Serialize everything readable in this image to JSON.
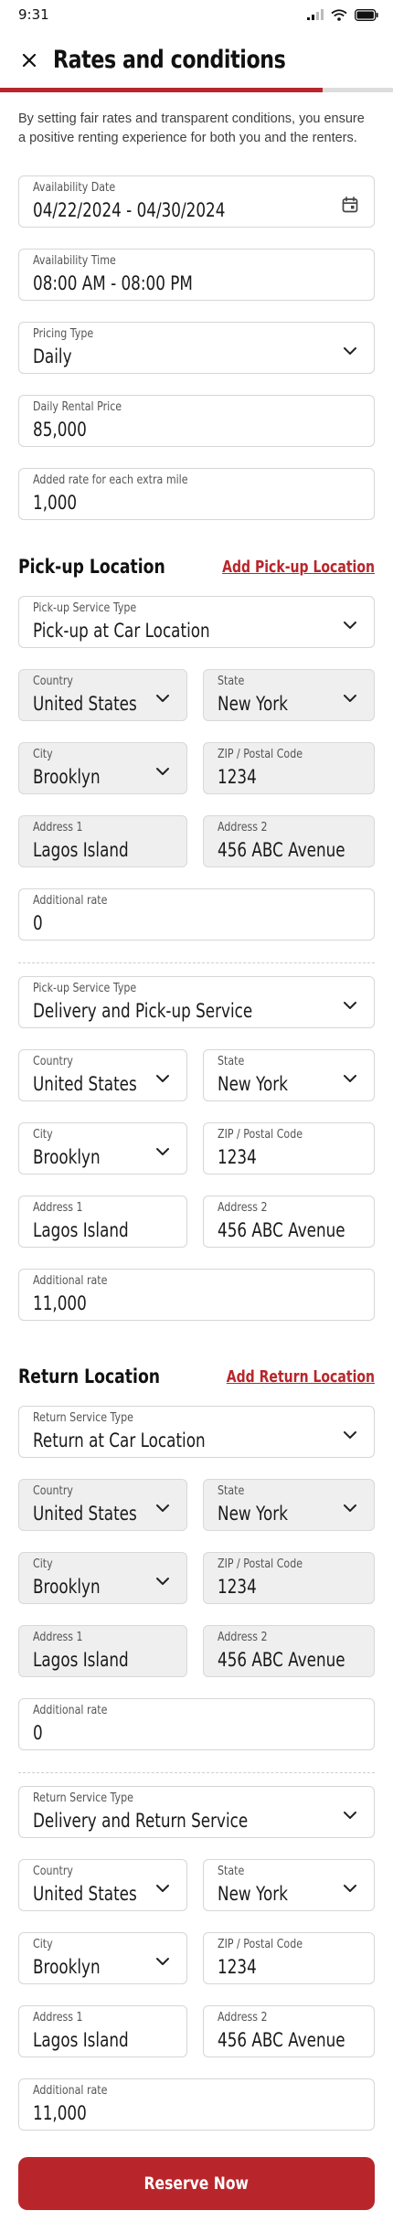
{
  "status_bar": {
    "time": "9:31",
    "icons": [
      "signal-icon",
      "wifi-icon",
      "battery-icon"
    ]
  },
  "header": {
    "title": "Rates and conditions",
    "close_icon": "close-icon"
  },
  "progress": {
    "fraction": 0.82
  },
  "colors": {
    "accent": "#b8262b",
    "field_border": "#d6d6d6",
    "disabled_bg": "#efefef"
  },
  "intro": "By setting fair rates and transparent conditions, you ensure a positive renting experience for both you and the renters.",
  "availability_date": {
    "label": "Availability Date",
    "value": "04/22/2024 - 04/30/2024",
    "icon": "calendar-icon"
  },
  "availability_time": {
    "label": "Availability Time",
    "value": "08:00 AM - 08:00 PM"
  },
  "pricing_type": {
    "label": "Pricing Type",
    "value": "Daily"
  },
  "daily_price": {
    "label": "Daily Rental Price",
    "value": "85,000"
  },
  "extra_mile": {
    "label": "Added rate for each extra mile",
    "value": "1,000"
  },
  "pickup": {
    "title": "Pick-up Location",
    "add_link": "Add Pick-up Location",
    "entries": [
      {
        "service_label": "Pick-up Service Type",
        "service_value": "Pick-up at Car Location",
        "country_label": "Country",
        "country_value": "United States",
        "state_label": "State",
        "state_value": "New York",
        "city_label": "City",
        "city_value": "Brooklyn",
        "zip_label": "ZIP / Postal Code",
        "zip_value": "1234",
        "address1_label": "Address 1",
        "address1_value": "Lagos Island",
        "address2_label": "Address 2",
        "address2_value": "456 ABC Avenue",
        "rate_label": "Additional rate",
        "rate_value": "0"
      },
      {
        "service_label": "Pick-up Service Type",
        "service_value": "Delivery and Pick-up Service",
        "country_label": "Country",
        "country_value": "United States",
        "state_label": "State",
        "state_value": "New York",
        "city_label": "City",
        "city_value": "Brooklyn",
        "zip_label": "ZIP / Postal Code",
        "zip_value": "1234",
        "address1_label": "Address 1",
        "address1_value": "Lagos Island",
        "address2_label": "Address 2",
        "address2_value": "456 ABC Avenue",
        "rate_label": "Additional rate",
        "rate_value": "11,000"
      }
    ]
  },
  "return": {
    "title": "Return Location",
    "add_link": "Add Return Location",
    "entries": [
      {
        "service_label": "Return Service Type",
        "service_value": "Return at Car Location",
        "country_label": "Country",
        "country_value": "United States",
        "state_label": "State",
        "state_value": "New York",
        "city_label": "City",
        "city_value": "Brooklyn",
        "zip_label": "ZIP / Postal Code",
        "zip_value": "1234",
        "address1_label": "Address 1",
        "address1_value": "Lagos Island",
        "address2_label": "Address 2",
        "address2_value": "456 ABC Avenue",
        "rate_label": "Additional rate",
        "rate_value": "0"
      },
      {
        "service_label": "Return Service Type",
        "service_value": "Delivery and Return Service",
        "country_label": "Country",
        "country_value": "United States",
        "state_label": "State",
        "state_value": "New York",
        "city_label": "City",
        "city_value": "Brooklyn",
        "zip_label": "ZIP / Postal Code",
        "zip_value": "1234",
        "address1_label": "Address 1",
        "address1_value": "Lagos Island",
        "address2_label": "Address 2",
        "address2_value": "456 ABC Avenue",
        "rate_label": "Additional rate",
        "rate_value": "11,000"
      }
    ]
  },
  "reserve_button": "Reserve Now"
}
